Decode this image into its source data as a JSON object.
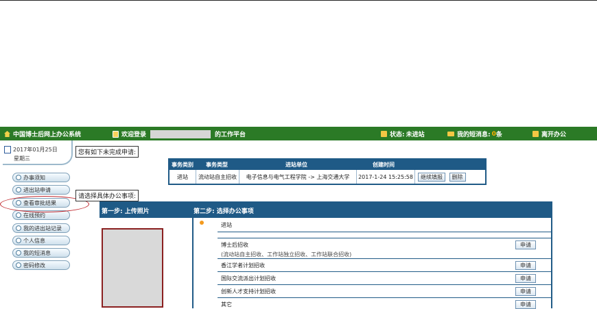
{
  "topbar": {
    "system_title": "中国博士后网上办公系统",
    "welcome": "欢迎登录",
    "platform": "的工作平台",
    "status_label": "状态:",
    "status_value": "未进站",
    "messages_label": "我的短消息:",
    "messages_count": "0",
    "messages_unit": "条",
    "leave": "离开办公"
  },
  "date": {
    "date": "2017年01月25日",
    "weekday": "星期三"
  },
  "nav": [
    {
      "label": "办事须知"
    },
    {
      "label": "进出站申请"
    },
    {
      "label": "查看审批结果"
    },
    {
      "label": "在线预约"
    },
    {
      "label": "我的进出站记录"
    },
    {
      "label": "个人信息"
    },
    {
      "label": "我的短消息"
    },
    {
      "label": "密码修改"
    }
  ],
  "pending": {
    "heading": "您有如下未完成申请:",
    "columns": [
      "事务类别",
      "事务类型",
      "进站单位",
      "创建时间"
    ],
    "row": {
      "category": "进站",
      "type": "流动站自主招收",
      "unit": "电子信息与电气工程学院 -> 上海交通大学",
      "created": "2017-1-24 15:25:58",
      "continue_btn": "继续填报",
      "delete_btn": "删除"
    }
  },
  "select": {
    "heading": "请选择具体办公事项:",
    "step1": "第一步: 上传照片",
    "step2": "第二步: 选择办公事项",
    "category": "进站",
    "items": [
      {
        "title": "博士后招收",
        "sub": "(流动站自主招收、工作站独立招收、工作站联合招收)",
        "action": "申请"
      },
      {
        "title": "香江学者计划招收",
        "action": "申请"
      },
      {
        "title": "国际交流派出计划招收",
        "action": "申请"
      },
      {
        "title": "创新人才支持计划招收",
        "action": "申请"
      },
      {
        "title": "其它",
        "action": "申请"
      }
    ]
  }
}
